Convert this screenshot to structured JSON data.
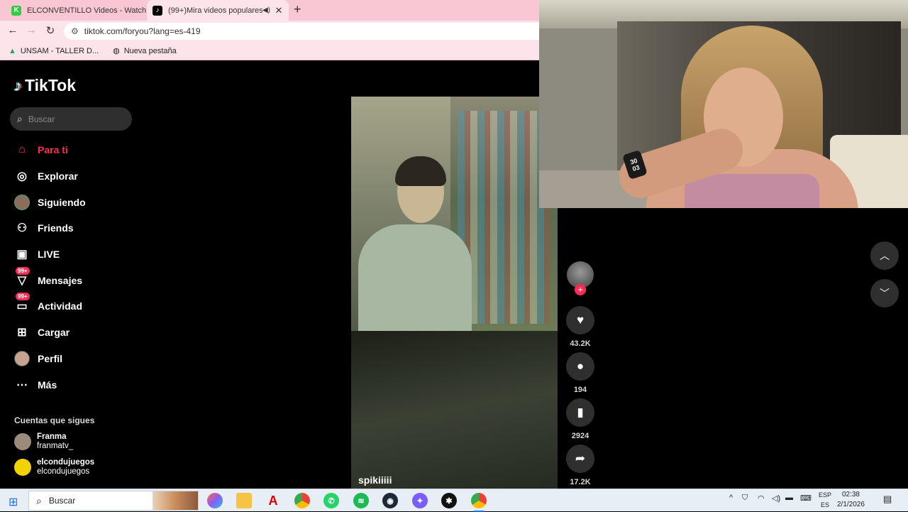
{
  "browser": {
    "tabs": [
      {
        "title": "ELCONVENTILLO Videos - Watch",
        "favicon": "K",
        "favicon_color": "#2ecc40"
      },
      {
        "title": "(99+)Mira videos populares",
        "favicon": "♪",
        "favicon_color": "#000000"
      }
    ],
    "url": "tiktok.com/foryou?lang=es-419",
    "bookmarks": [
      {
        "label": "UNSAM - TALLER D..."
      },
      {
        "label": "Nueva pestaña"
      }
    ]
  },
  "tiktok": {
    "logo": "TikTok",
    "search_placeholder": "Buscar",
    "nav": [
      {
        "label": "Para ti",
        "icon": "home-icon",
        "active": true
      },
      {
        "label": "Explorar",
        "icon": "compass-icon"
      },
      {
        "label": "Siguiendo",
        "icon": "following-avatar-icon"
      },
      {
        "label": "Friends",
        "icon": "friends-icon"
      },
      {
        "label": "LIVE",
        "icon": "live-tv-icon"
      },
      {
        "label": "Mensajes",
        "icon": "messages-icon",
        "badge": "99+"
      },
      {
        "label": "Actividad",
        "icon": "activity-icon",
        "badge": "99+"
      },
      {
        "label": "Cargar",
        "icon": "upload-icon"
      },
      {
        "label": "Perfil",
        "icon": "profile-avatar-icon"
      },
      {
        "label": "Más",
        "icon": "more-icon"
      }
    ],
    "following_title": "Cuentas que sigues",
    "following": [
      {
        "name": "Franma",
        "handle": "franmatv_"
      },
      {
        "name": "elcondujuegos",
        "handle": "elcondujuegos"
      }
    ],
    "video": {
      "username": "spikiiiii",
      "likes": "43.2K",
      "comments": "194",
      "saves": "2924",
      "shares": "17.2K"
    }
  },
  "taskbar": {
    "search_label": "Buscar",
    "lang_top": "ESP",
    "lang_bottom": "ES",
    "time": "02:38",
    "date": "2/1/2026"
  },
  "webcam": {
    "watch_text": "30\n03"
  }
}
